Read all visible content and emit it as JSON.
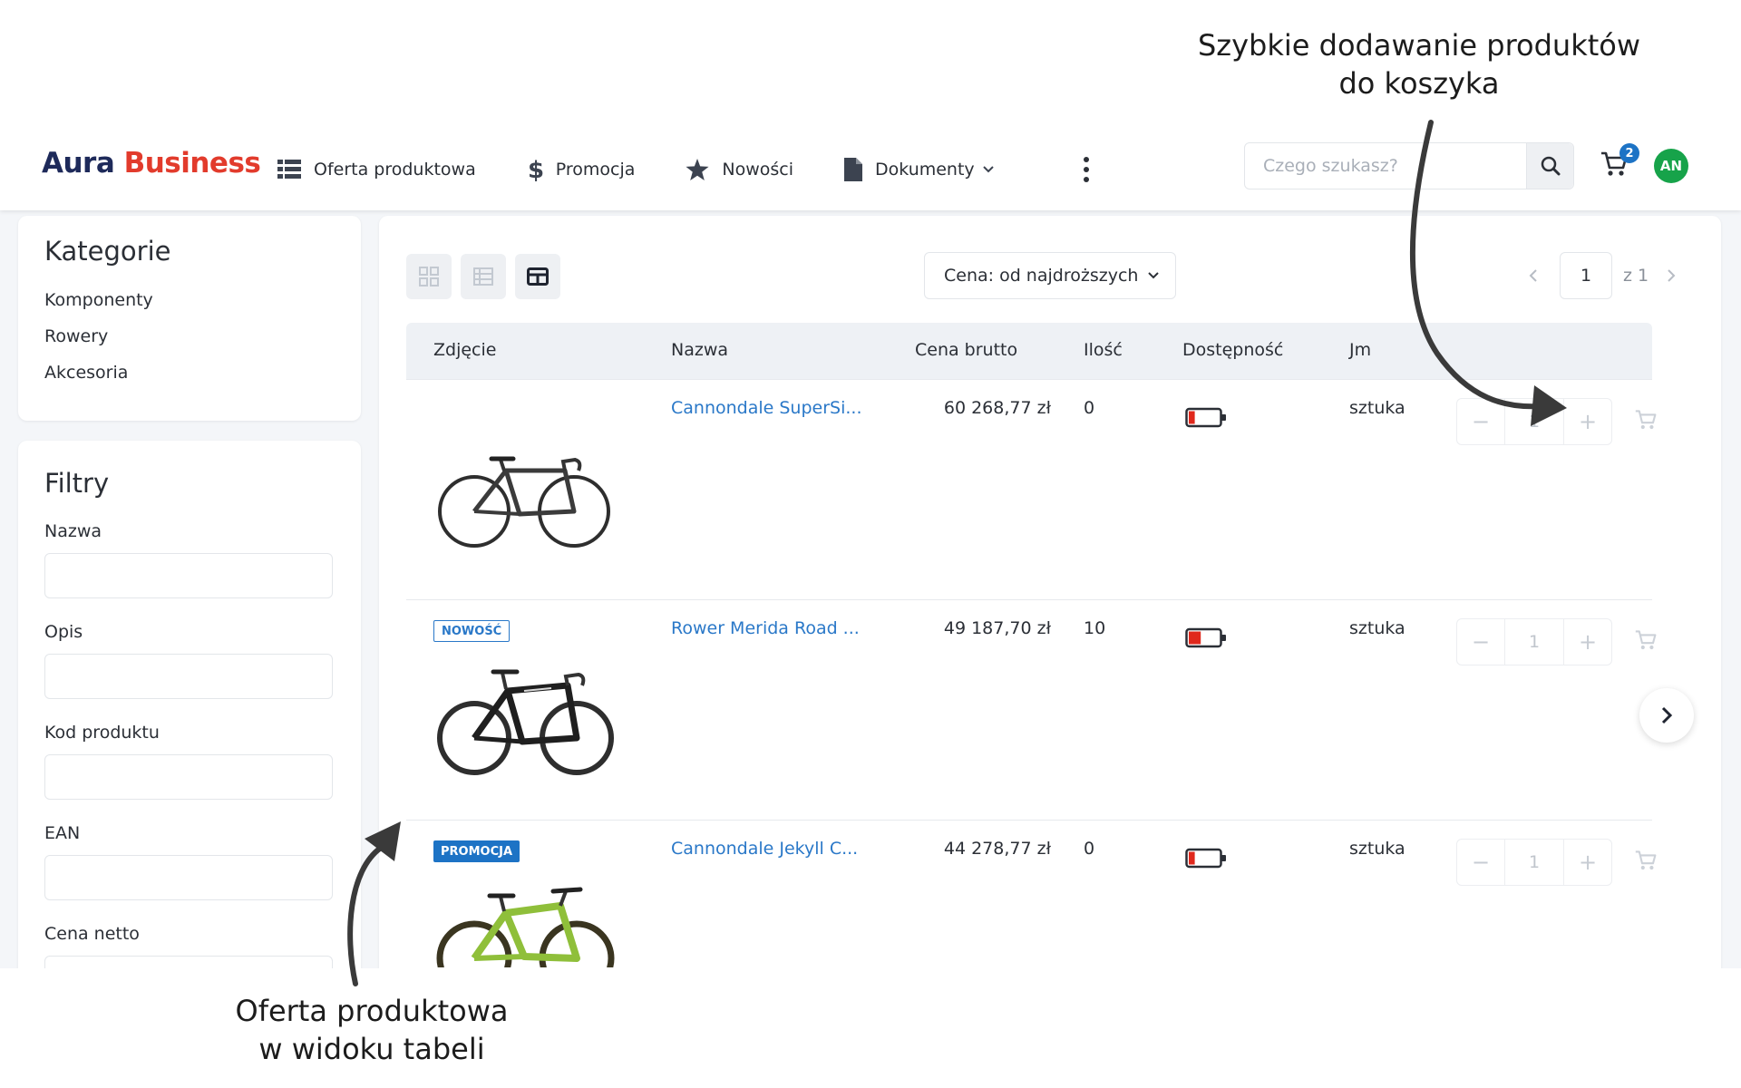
{
  "annotations": {
    "top_line1": "Szybkie dodawanie produktów",
    "top_line2": "do koszyka",
    "bottom_line1": "Oferta produktowa",
    "bottom_line2": "w widoku tabeli"
  },
  "header": {
    "logo_part1": "Aura",
    "logo_part2": "Business",
    "nav": [
      {
        "label": "Oferta produktowa",
        "icon": "list-icon"
      },
      {
        "label": "Promocja",
        "icon": "dollar-icon"
      },
      {
        "label": "Nowości",
        "icon": "star-icon"
      },
      {
        "label": "Dokumenty",
        "icon": "document-icon"
      }
    ],
    "search_placeholder": "Czego szukasz?",
    "cart_count": "2",
    "avatar_initials": "AN"
  },
  "sidebar": {
    "categories_title": "Kategorie",
    "categories": [
      "Komponenty",
      "Rowery",
      "Akcesoria"
    ],
    "filters_title": "Filtry",
    "filters": [
      "Nazwa",
      "Opis",
      "Kod produktu",
      "EAN",
      "Cena netto"
    ]
  },
  "toolbar": {
    "sort_label": "Cena: od najdroższych",
    "page_current": "1",
    "page_total": "z 1"
  },
  "table": {
    "columns": [
      "Zdjęcie",
      "Nazwa",
      "Cena brutto",
      "Ilość",
      "Dostępność",
      "Jm"
    ],
    "rows": [
      {
        "tag": "",
        "name": "Cannondale SuperSi...",
        "price": "60 268,77 zł",
        "qty": "0",
        "availability_fill": 0.2,
        "unit": "sztuka",
        "qty_input": "1"
      },
      {
        "tag": "NOWOŚĆ",
        "name": "Rower Merida Road ...",
        "price": "49 187,70 zł",
        "qty": "10",
        "availability_fill": 0.4,
        "unit": "sztuka",
        "qty_input": "1"
      },
      {
        "tag": "PROMOCJA",
        "name": "Cannondale Jekyll C...",
        "price": "44 278,77 zł",
        "qty": "0",
        "availability_fill": 0.2,
        "unit": "sztuka",
        "qty_input": "1"
      }
    ]
  },
  "colors": {
    "brand_dark": "#1e2a5a",
    "brand_red": "#e23b2c",
    "link": "#2a78c8",
    "badge": "#1d73c5",
    "avatar": "#17a34a",
    "battery_low": "#e0281c"
  }
}
